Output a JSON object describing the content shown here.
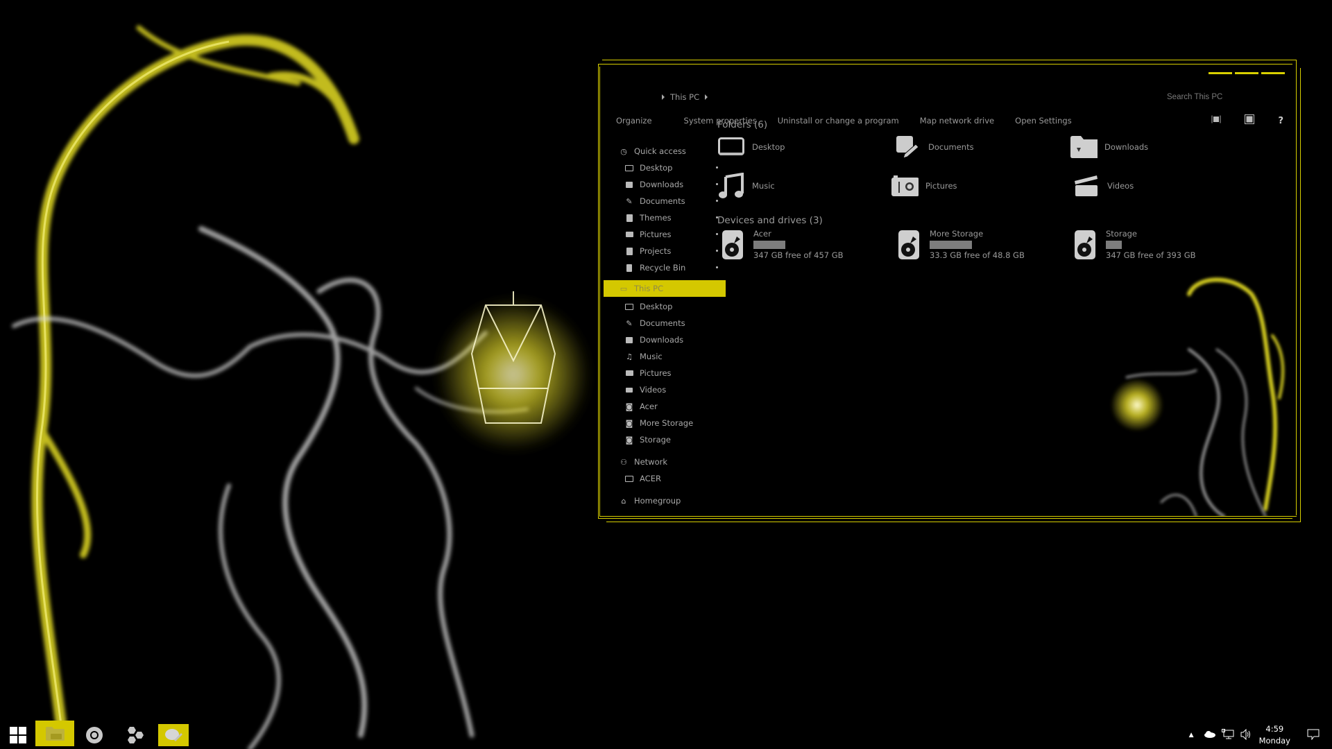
{
  "colors": {
    "accent": "#d4c800",
    "frame": "#d9d000",
    "text": "#9a9a9a",
    "drive_bar": "#7d7d7d"
  },
  "window": {
    "title_buttons": [
      "minimize",
      "maximize",
      "close"
    ],
    "breadcrumb": [
      "This PC"
    ],
    "search_placeholder": "Search This PC",
    "commands": [
      "Organize",
      "System properties",
      "Uninstall or change a program",
      "Map network drive",
      "Open Settings"
    ],
    "command_icons": [
      "preview-pane-icon",
      "view-icon",
      "help-icon"
    ],
    "help_label": "?"
  },
  "nav": {
    "quick_access": {
      "label": "Quick access",
      "items": [
        {
          "label": "Desktop",
          "icon": "desktop-icon",
          "pinned": true
        },
        {
          "label": "Downloads",
          "icon": "downloads-icon",
          "pinned": true
        },
        {
          "label": "Documents",
          "icon": "documents-icon",
          "pinned": true
        },
        {
          "label": "Themes",
          "icon": "folder-icon",
          "pinned": true
        },
        {
          "label": "Pictures",
          "icon": "pictures-icon",
          "pinned": true
        },
        {
          "label": "Projects",
          "icon": "folder-icon",
          "pinned": true
        },
        {
          "label": "Recycle Bin",
          "icon": "recycle-bin-icon",
          "pinned": true
        }
      ]
    },
    "this_pc": {
      "label": "This PC",
      "selected": true,
      "items": [
        {
          "label": "Desktop",
          "icon": "desktop-icon"
        },
        {
          "label": "Documents",
          "icon": "documents-icon"
        },
        {
          "label": "Downloads",
          "icon": "downloads-icon"
        },
        {
          "label": "Music",
          "icon": "music-icon"
        },
        {
          "label": "Pictures",
          "icon": "pictures-icon"
        },
        {
          "label": "Videos",
          "icon": "videos-icon"
        },
        {
          "label": "Acer",
          "icon": "drive-icon"
        },
        {
          "label": "More Storage",
          "icon": "drive-icon"
        },
        {
          "label": "Storage",
          "icon": "drive-icon"
        }
      ]
    },
    "network": {
      "label": "Network",
      "items": [
        {
          "label": "ACER",
          "icon": "computer-icon"
        }
      ]
    },
    "homegroup": {
      "label": "Homegroup"
    }
  },
  "content": {
    "folders_header": "Folders (6)",
    "folders": [
      {
        "label": "Desktop",
        "icon": "desktop-icon"
      },
      {
        "label": "Documents",
        "icon": "documents-icon"
      },
      {
        "label": "Downloads",
        "icon": "downloads-icon"
      },
      {
        "label": "Music",
        "icon": "music-icon"
      },
      {
        "label": "Pictures",
        "icon": "pictures-icon"
      },
      {
        "label": "Videos",
        "icon": "videos-icon"
      }
    ],
    "drives_header": "Devices and drives (3)",
    "drives": [
      {
        "label": "Acer",
        "free_text": "347 GB free of 457 GB",
        "used_fraction": 0.24
      },
      {
        "label": "More Storage",
        "free_text": "33.3 GB free of 48.8 GB",
        "used_fraction": 0.32
      },
      {
        "label": "Storage",
        "free_text": "347 GB free of 393 GB",
        "used_fraction": 0.12
      }
    ]
  },
  "taskbar": {
    "items": [
      {
        "name": "start-button",
        "active": false
      },
      {
        "name": "file-explorer",
        "active": true
      },
      {
        "name": "chrome",
        "active": false
      },
      {
        "name": "hexagon-app",
        "active": false
      },
      {
        "name": "notes-app",
        "active": true
      }
    ],
    "tray": {
      "icons": [
        "show-hidden-icons",
        "onedrive-icon",
        "network-icon",
        "volume-icon"
      ],
      "time": "4:59",
      "day": "Monday"
    }
  }
}
